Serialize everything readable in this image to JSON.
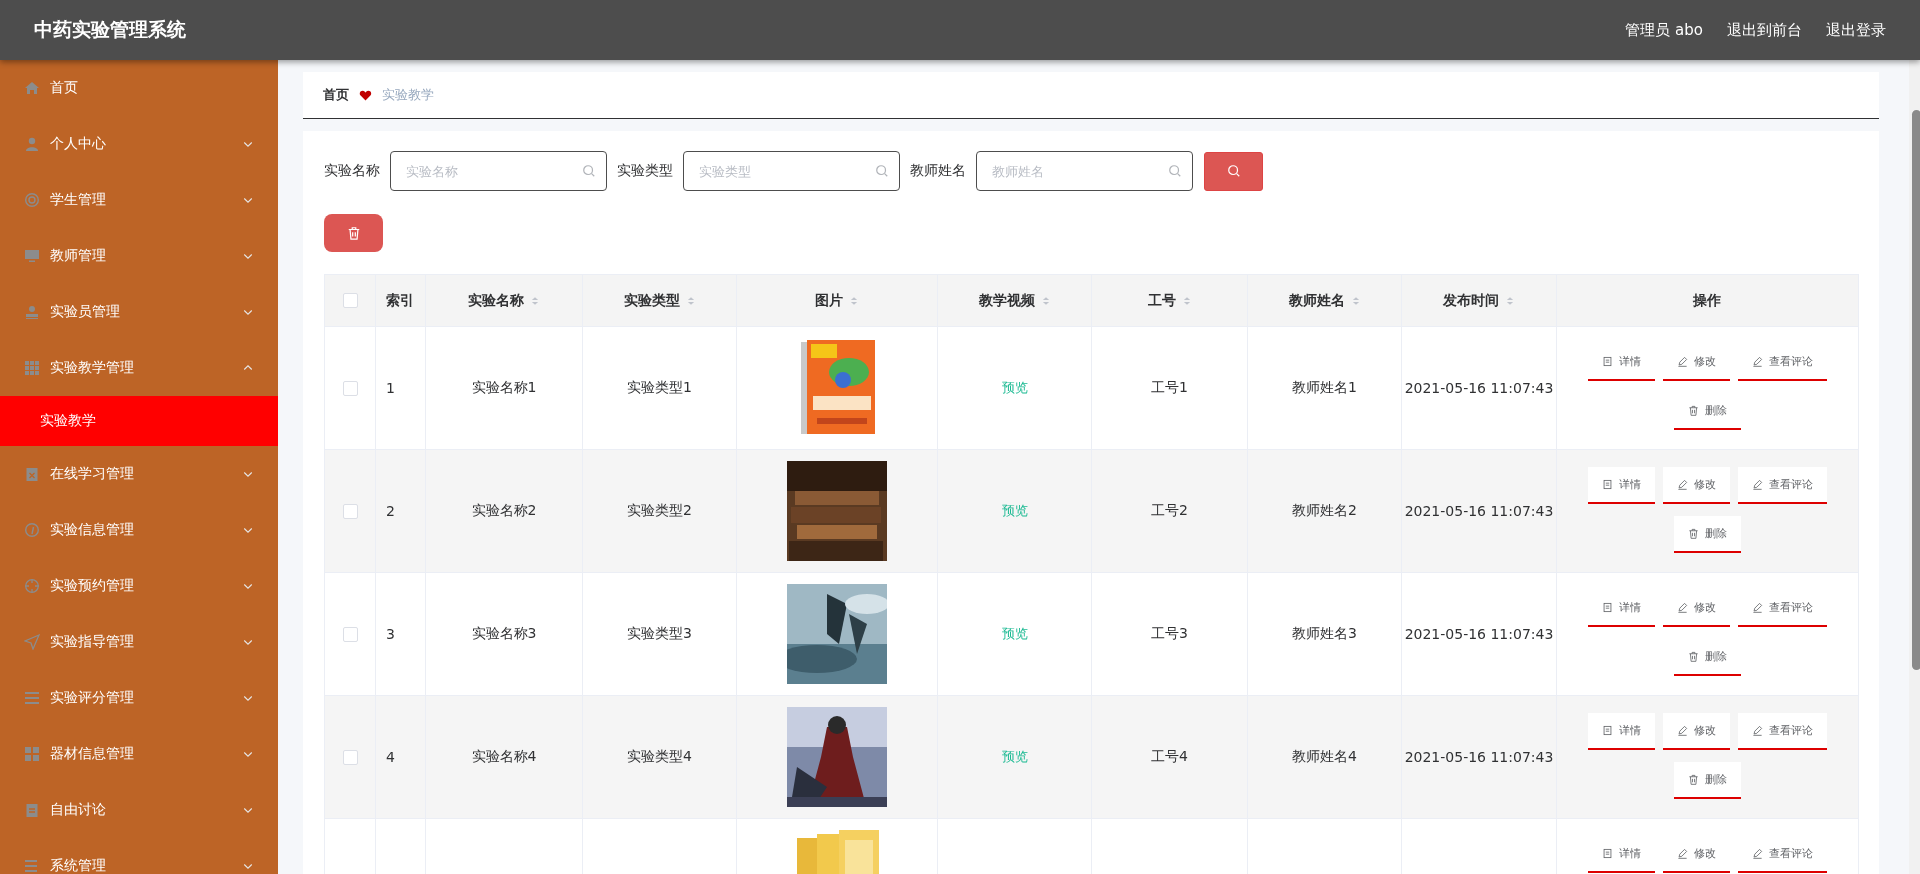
{
  "app_title": "中药实验管理系统",
  "header_links": [
    "管理员 abo",
    "退出到前台",
    "退出登录"
  ],
  "sidebar": {
    "items": [
      {
        "label": "首页",
        "kind": "link"
      },
      {
        "label": "个人中心",
        "kind": "group",
        "expanded": false
      },
      {
        "label": "学生管理",
        "kind": "group",
        "expanded": false
      },
      {
        "label": "教师管理",
        "kind": "group",
        "expanded": false
      },
      {
        "label": "实验员管理",
        "kind": "group",
        "expanded": false
      },
      {
        "label": "实验教学管理",
        "kind": "group",
        "expanded": true,
        "children": [
          {
            "label": "实验教学",
            "selected": true
          }
        ]
      },
      {
        "label": "在线学习管理",
        "kind": "group",
        "expanded": false
      },
      {
        "label": "实验信息管理",
        "kind": "group",
        "expanded": false
      },
      {
        "label": "实验预约管理",
        "kind": "group",
        "expanded": false
      },
      {
        "label": "实验指导管理",
        "kind": "group",
        "expanded": false
      },
      {
        "label": "实验评分管理",
        "kind": "group",
        "expanded": false
      },
      {
        "label": "器材信息管理",
        "kind": "group",
        "expanded": false
      },
      {
        "label": "自由讨论",
        "kind": "group",
        "expanded": false
      },
      {
        "label": "系统管理",
        "kind": "group",
        "expanded": false
      }
    ]
  },
  "breadcrumb": [
    "首页",
    "实验教学"
  ],
  "search": {
    "fields": [
      {
        "label": "实验名称",
        "placeholder": "实验名称"
      },
      {
        "label": "实验类型",
        "placeholder": "实验类型"
      },
      {
        "label": "教师姓名",
        "placeholder": "教师姓名"
      }
    ]
  },
  "table": {
    "select_all": {
      "checked": false
    },
    "columns": [
      {
        "label": "索引",
        "sortable": false
      },
      {
        "label": "实验名称",
        "sortable": true
      },
      {
        "label": "实验类型",
        "sortable": true
      },
      {
        "label": "图片",
        "sortable": true
      },
      {
        "label": "教学视频",
        "sortable": true
      },
      {
        "label": "工号",
        "sortable": true
      },
      {
        "label": "教师姓名",
        "sortable": true
      },
      {
        "label": "发布时间",
        "sortable": true
      },
      {
        "label": "操作",
        "sortable": false
      }
    ],
    "rows": [
      {
        "selected": false,
        "index": "1",
        "name": "实验名称1",
        "type": "实验类型1",
        "image": {
          "kind": "picture"
        },
        "video": "预览",
        "job_no": "工号1",
        "teacher": "教师姓名1",
        "time": "2021-05-16 11:07:43",
        "actions": [
          "详情",
          "修改",
          "查看评论",
          "删除"
        ]
      },
      {
        "selected": false,
        "index": "2",
        "name": "实验名称2",
        "type": "实验类型2",
        "image": {
          "kind": "picture"
        },
        "video": "预览",
        "job_no": "工号2",
        "teacher": "教师姓名2",
        "time": "2021-05-16 11:07:43",
        "actions": [
          "详情",
          "修改",
          "查看评论",
          "删除"
        ]
      },
      {
        "selected": false,
        "index": "3",
        "name": "实验名称3",
        "type": "实验类型3",
        "image": {
          "kind": "picture"
        },
        "video": "预览",
        "job_no": "工号3",
        "teacher": "教师姓名3",
        "time": "2021-05-16 11:07:43",
        "actions": [
          "详情",
          "修改",
          "查看评论",
          "删除"
        ]
      },
      {
        "selected": false,
        "index": "4",
        "name": "实验名称4",
        "type": "实验类型4",
        "image": {
          "kind": "picture"
        },
        "video": "预览",
        "job_no": "工号4",
        "teacher": "教师姓名4",
        "time": "2021-05-16 11:07:43",
        "actions": [
          "详情",
          "修改",
          "查看评论",
          "删除"
        ]
      },
      {
        "image": {
          "kind": "picture"
        },
        "actions": [
          "详情",
          "修改",
          "查看评论"
        ]
      }
    ]
  }
}
